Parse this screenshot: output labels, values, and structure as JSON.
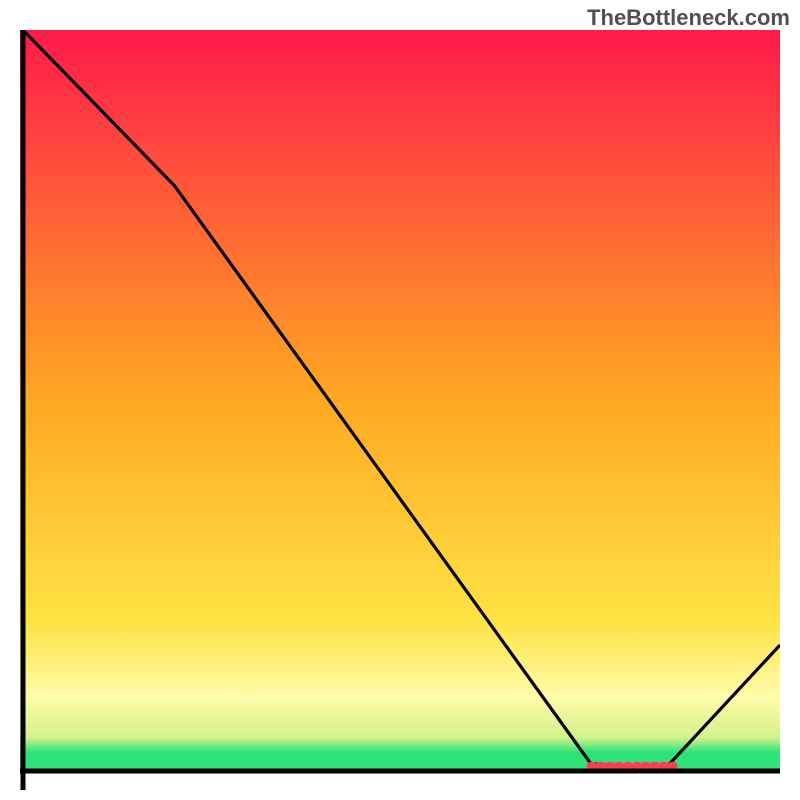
{
  "watermark": "TheBottleneck.com",
  "chart_data": {
    "type": "line",
    "title": "",
    "xlabel": "",
    "ylabel": "",
    "xlim": [
      0,
      100
    ],
    "ylim": [
      0,
      100
    ],
    "series": [
      {
        "name": "bottleneck-curve",
        "x": [
          0,
          20,
          75,
          80,
          85,
          100
        ],
        "y": [
          100,
          79,
          1,
          0.5,
          0.5,
          17
        ]
      }
    ],
    "gradient_stops": [
      {
        "offset": 0.0,
        "color": "#ff1a4b"
      },
      {
        "offset": 0.5,
        "color": "#ffa921"
      },
      {
        "offset": 0.8,
        "color": "#ffe345"
      },
      {
        "offset": 0.9,
        "color": "#fffca9"
      },
      {
        "offset": 0.955,
        "color": "#d4f28a"
      },
      {
        "offset": 0.975,
        "color": "#2ee27a"
      }
    ],
    "optimum_marker": {
      "x_start": 75,
      "x_end": 86,
      "y": 0.7,
      "color": "#ff3e4d"
    },
    "axis_color": "#000000"
  }
}
